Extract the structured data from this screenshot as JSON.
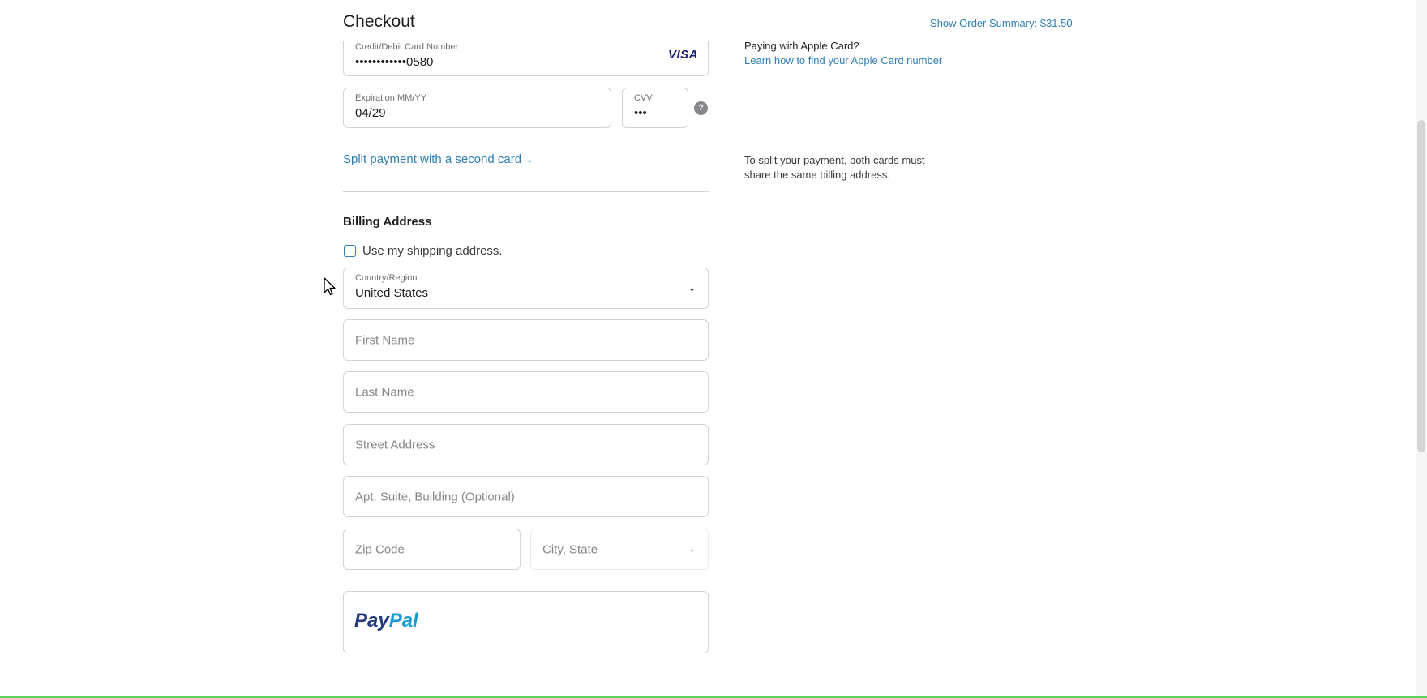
{
  "header": {
    "title": "Checkout",
    "order_summary": "Show Order Summary: $31.50"
  },
  "card": {
    "number_label": "Credit/Debit Card Number",
    "number_value": "••••••••••••0580",
    "brand": "VISA",
    "expiration_label": "Expiration MM/YY",
    "expiration_value": "04/29",
    "cvv_label": "CVV",
    "cvv_value": "•••",
    "help_icon": "?"
  },
  "apple_card": {
    "question": "Paying with Apple Card?",
    "link": "Learn how to find your Apple Card number"
  },
  "split": {
    "link": "Split payment with a second card",
    "note": "To split your payment, both cards must share the same billing address."
  },
  "billing": {
    "title": "Billing Address",
    "use_shipping_label": "Use my shipping address.",
    "use_shipping_checked": false,
    "country_label": "Country/Region",
    "country_value": "United States",
    "first_name_placeholder": "First Name",
    "last_name_placeholder": "Last Name",
    "street_placeholder": "Street Address",
    "apt_placeholder": "Apt, Suite, Building (Optional)",
    "zip_placeholder": "Zip Code",
    "city_state_placeholder": "City, State"
  },
  "paypal": {
    "logo_part1": "Pay",
    "logo_part2": "Pal"
  },
  "colors": {
    "link": "#2f7fb6",
    "paypal_dark": "#253b80",
    "paypal_light": "#179bd7",
    "visa": "#1a1f71"
  }
}
